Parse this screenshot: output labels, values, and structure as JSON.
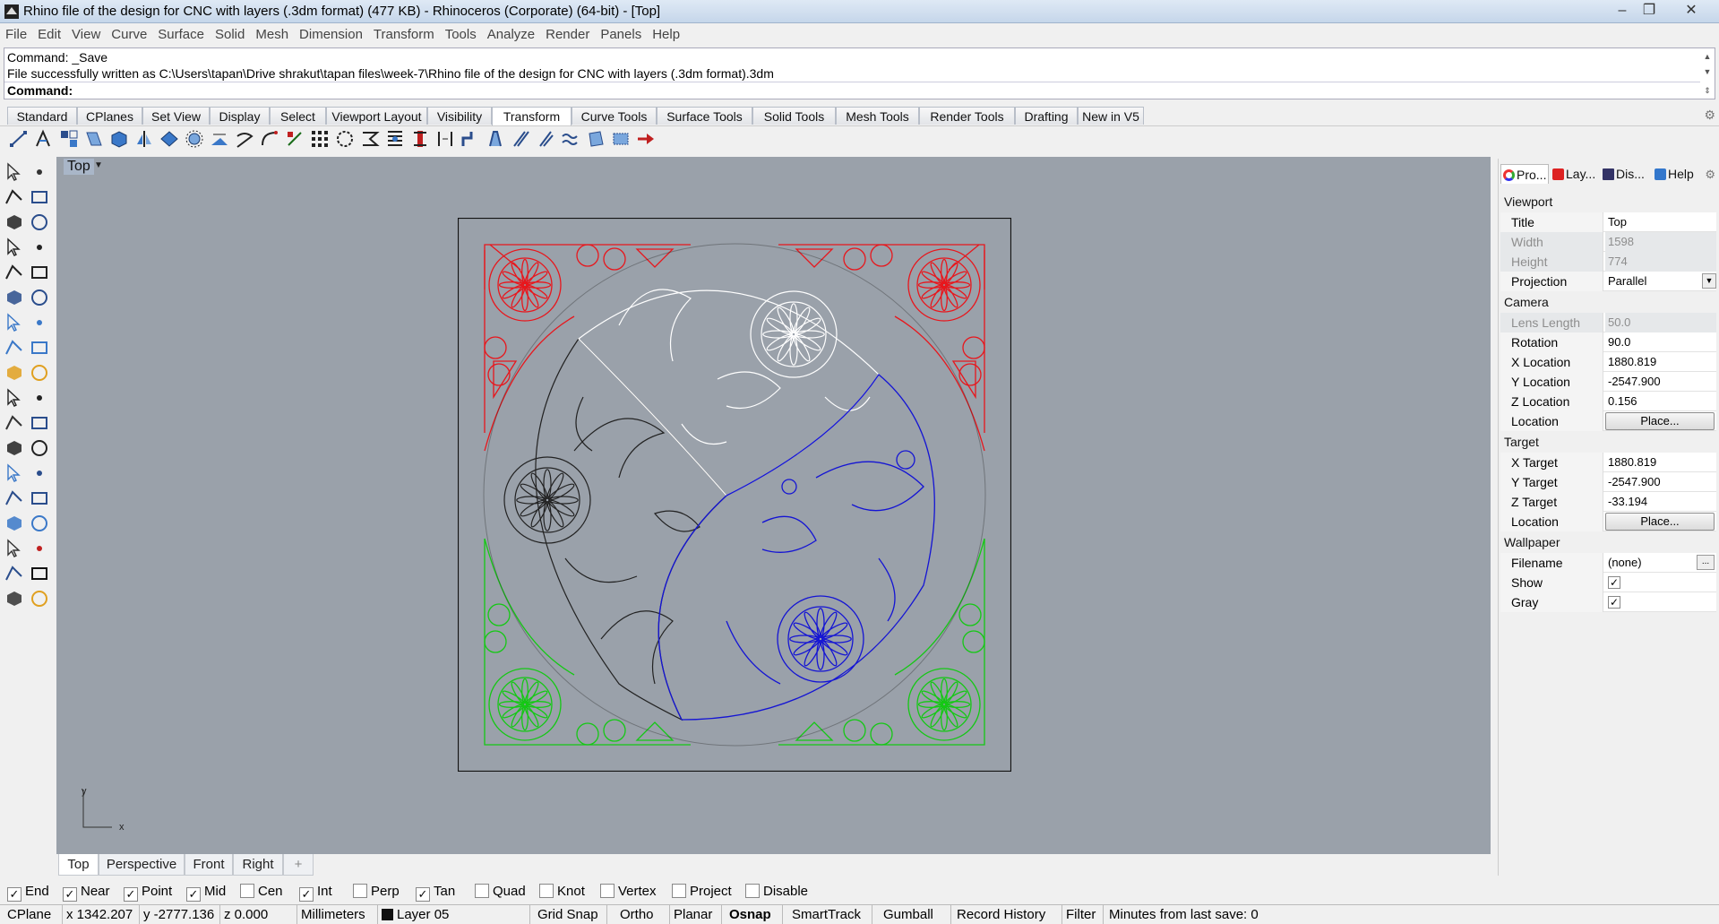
{
  "window": {
    "title": "Rhino file of the design for CNC with layers (.3dm format) (477 KB) - Rhinoceros (Corporate) (64-bit) - [Top]",
    "minimize": "‒",
    "maximize": "❐",
    "close": "✕"
  },
  "menu": [
    "File",
    "Edit",
    "View",
    "Curve",
    "Surface",
    "Solid",
    "Mesh",
    "Dimension",
    "Transform",
    "Tools",
    "Analyze",
    "Render",
    "Panels",
    "Help"
  ],
  "command": {
    "history_1": "Command: _Save",
    "history_2": "File successfully written as C:\\Users\\tapan\\Drive shrakut\\tapan files\\week-7\\Rhino file of the design for CNC with layers (.3dm format).3dm",
    "prompt": "Command:"
  },
  "toolbar_tabs": [
    "Standard",
    "CPlanes",
    "Set View",
    "Display",
    "Select",
    "Viewport Layout",
    "Visibility",
    "Transform",
    "Curve Tools",
    "Surface Tools",
    "Solid Tools",
    "Mesh Tools",
    "Render Tools",
    "Drafting",
    "New in V5"
  ],
  "active_toolbar_tab": "Transform",
  "viewport": {
    "label": "Top",
    "axis_x": "x",
    "axis_y": "y",
    "tabs": [
      "Top",
      "Perspective",
      "Front",
      "Right"
    ],
    "add_tab": "+",
    "layer_colors": {
      "red": "#e8161c",
      "white": "#ffffff",
      "black": "#222222",
      "blue": "#1414d4",
      "green": "#14c814"
    }
  },
  "osnaps": [
    {
      "label": "End",
      "checked": true
    },
    {
      "label": "Near",
      "checked": true
    },
    {
      "label": "Point",
      "checked": true
    },
    {
      "label": "Mid",
      "checked": true
    },
    {
      "label": "Cen",
      "checked": false
    },
    {
      "label": "Int",
      "checked": true
    },
    {
      "label": "Perp",
      "checked": false
    },
    {
      "label": "Tan",
      "checked": true
    },
    {
      "label": "Quad",
      "checked": false
    },
    {
      "label": "Knot",
      "checked": false
    },
    {
      "label": "Vertex",
      "checked": false
    },
    {
      "label": "Project",
      "checked": false
    },
    {
      "label": "Disable",
      "checked": false
    }
  ],
  "status": {
    "cplane": "CPlane",
    "x": "x 1342.207",
    "y": "y -2777.136",
    "z": "z 0.000",
    "units": "Millimeters",
    "layer": "Layer 05",
    "grid_snap": "Grid Snap",
    "ortho": "Ortho",
    "planar": "Planar",
    "osnap": "Osnap",
    "smarttrack": "SmartTrack",
    "gumball": "Gumball",
    "record_history": "Record History",
    "filter": "Filter",
    "minutes": "Minutes from last save: 0"
  },
  "panel": {
    "tabs": [
      "Pro...",
      "Lay...",
      "Dis...",
      "Help"
    ],
    "viewport_section": "Viewport",
    "title_label": "Title",
    "title_value": "Top",
    "width_label": "Width",
    "width_value": "1598",
    "height_label": "Height",
    "height_value": "774",
    "projection_label": "Projection",
    "projection_value": "Parallel",
    "camera_section": "Camera",
    "lens_label": "Lens Length",
    "lens_value": "50.0",
    "rotation_label": "Rotation",
    "rotation_value": "90.0",
    "xloc_label": "X Location",
    "xloc_value": "1880.819",
    "yloc_label": "Y Location",
    "yloc_value": "-2547.900",
    "zloc_label": "Z Location",
    "zloc_value": "0.156",
    "location_label": "Location",
    "place_button": "Place...",
    "target_section": "Target",
    "xt_label": "X Target",
    "xt_value": "1880.819",
    "yt_label": "Y Target",
    "yt_value": "-2547.900",
    "zt_label": "Z Target",
    "zt_value": "-33.194",
    "tloc_label": "Location",
    "tplace_button": "Place...",
    "wallpaper_section": "Wallpaper",
    "filename_label": "Filename",
    "filename_value": "(none)",
    "browse_button": "...",
    "show_label": "Show",
    "show_checked": true,
    "gray_label": "Gray",
    "gray_checked": true
  }
}
